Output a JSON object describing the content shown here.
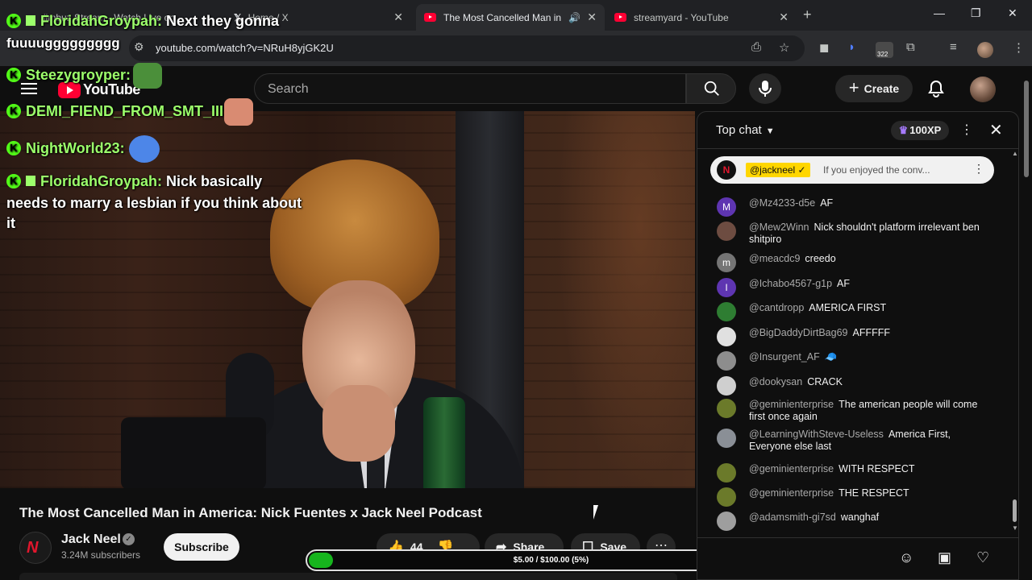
{
  "browser": {
    "tabs": [
      {
        "label": "jimbuz Stream - Watch Live on",
        "active": false
      },
      {
        "label": "Home / X",
        "active": false
      },
      {
        "label": "The Most Cancelled Man in",
        "active": true
      },
      {
        "label": "streamyard - YouTube",
        "active": false
      }
    ],
    "url": "youtube.com/watch?v=NRuH8yjGK2U",
    "extension_badge": "322"
  },
  "youtube": {
    "logo_text": "YouTube",
    "search_placeholder": "Search",
    "create_label": "Create"
  },
  "overlay_chat": [
    {
      "name": "FloridahGroypah:",
      "text": "Next they gonna",
      "badge": "gift"
    },
    {
      "name": "",
      "text": "fuuuuggggggggg",
      "badge": ""
    },
    {
      "name": "Steezygroyper:",
      "text": "",
      "badge": "none"
    },
    {
      "name": "DEMI_FIEND_FROM_SMT_III:",
      "text": "",
      "badge": "none"
    },
    {
      "name": "NightWorld23:",
      "text": "",
      "badge": "none"
    },
    {
      "name": "FloridahGroypah:",
      "text": "Nick basically",
      "badge": "gift"
    },
    {
      "name": "",
      "text": "needs to marry a lesbian if you think about",
      "badge": ""
    },
    {
      "name": "",
      "text": "it",
      "badge": ""
    }
  ],
  "video": {
    "title": "The Most Cancelled Man in America: Nick Fuentes x Jack Neel Podcast",
    "channel_name": "Jack Neel",
    "subscribers": "3.24M subscribers",
    "subscribe_label": "Subscribe",
    "likes": "44",
    "share_label": "Share",
    "save_label": "Save"
  },
  "donation_goal": {
    "text": "$5.00 / $100.00 (5%)",
    "fraction": 0.05
  },
  "live_chat": {
    "mode": "Top chat",
    "xp": "100XP",
    "pinned": {
      "author": "@jackneel",
      "message": "If you enjoyed the conv..."
    },
    "messages": [
      {
        "author": "@Mz4233-d5e",
        "text": "AF",
        "initial": "M",
        "color": "#5e35b1"
      },
      {
        "author": "@Mew2Winn",
        "text": "Nick shouldn't platform irrelevant ben shitpiro",
        "initial": "",
        "color": "#6d4c41"
      },
      {
        "author": "@meacdc9",
        "text": "creedo",
        "initial": "m",
        "color": "#757575"
      },
      {
        "author": "@Ichabo4567-g1p",
        "text": "AF",
        "initial": "I",
        "color": "#5e35b1"
      },
      {
        "author": "@cantdropp",
        "text": "AMERICA FIRST",
        "initial": "",
        "color": "#2e7d32"
      },
      {
        "author": "@BigDaddyDirtBag69",
        "text": "AFFFFF",
        "initial": "",
        "color": "#e0e0e0"
      },
      {
        "author": "@Insurgent_AF",
        "text": "🧢",
        "initial": "",
        "color": "#8d8d8d"
      },
      {
        "author": "@dookysan",
        "text": "CRACK",
        "initial": "",
        "color": "#cfcfcf"
      },
      {
        "author": "@geminienterprise",
        "text": "The american people will come first once again",
        "initial": "",
        "color": "#6b7a2a"
      },
      {
        "author": "@LearningWithSteve-Useless",
        "text": "America First, Everyone else last",
        "initial": "",
        "color": "#8a8f96"
      },
      {
        "author": "@geminienterprise",
        "text": "WITH RESPECT",
        "initial": "",
        "color": "#6b7a2a"
      },
      {
        "author": "@geminienterprise",
        "text": "THE RESPECT",
        "initial": "",
        "color": "#6b7a2a"
      },
      {
        "author": "@adamsmith-gi7sd",
        "text": "wanghaf",
        "initial": "",
        "color": "#9e9e9e"
      }
    ]
  }
}
